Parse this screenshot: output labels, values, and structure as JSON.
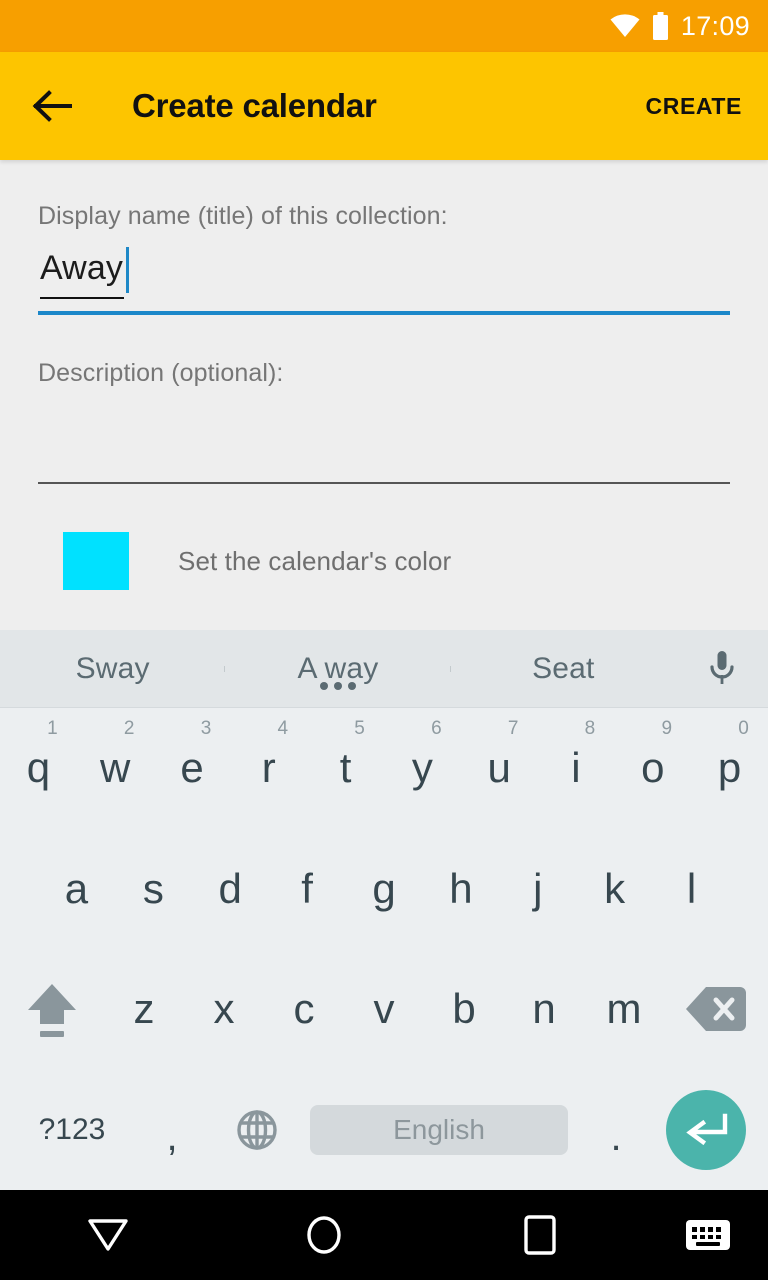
{
  "status_bar": {
    "time": "17:09",
    "wifi_icon": "wifi-icon",
    "battery_icon": "battery-icon",
    "background_color": "#f79f00"
  },
  "app_bar": {
    "back_icon": "arrow-left-icon",
    "title": "Create calendar",
    "action_label": "CREATE",
    "background_color": "#fdc500"
  },
  "form": {
    "name_label": "Display name (title) of this collection:",
    "name_value": "Away",
    "name_underline_color": "#1b87c9",
    "description_label": "Description (optional):",
    "description_value": "",
    "color_swatch": "#00e1ff",
    "color_label": "Set the calendar's color"
  },
  "keyboard": {
    "suggestions": [
      {
        "label": "Sway",
        "has_more_dots": false
      },
      {
        "label": "A way",
        "has_more_dots": true
      },
      {
        "label": "Seat",
        "has_more_dots": false
      }
    ],
    "mic_icon": "microphone-icon",
    "row1": [
      {
        "letter": "q",
        "num": "1"
      },
      {
        "letter": "w",
        "num": "2"
      },
      {
        "letter": "e",
        "num": "3"
      },
      {
        "letter": "r",
        "num": "4"
      },
      {
        "letter": "t",
        "num": "5"
      },
      {
        "letter": "y",
        "num": "6"
      },
      {
        "letter": "u",
        "num": "7"
      },
      {
        "letter": "i",
        "num": "8"
      },
      {
        "letter": "o",
        "num": "9"
      },
      {
        "letter": "p",
        "num": "0"
      }
    ],
    "row2": [
      "a",
      "s",
      "d",
      "f",
      "g",
      "h",
      "j",
      "k",
      "l"
    ],
    "row3": [
      "z",
      "x",
      "c",
      "v",
      "b",
      "n",
      "m"
    ],
    "shift_icon": "shift-arrow-up-icon",
    "backspace_icon": "backspace-delete-icon",
    "symbols_label": "?123",
    "comma_label": ",",
    "globe_icon": "globe-language-icon",
    "spacebar_label": "English",
    "period_label": ".",
    "enter_icon": "enter-return-icon",
    "enter_key_color": "#4bb4ab"
  },
  "nav_bar": {
    "back_icon": "nav-back-triangle-icon",
    "home_icon": "nav-home-circle-icon",
    "recents_icon": "nav-recents-square-icon",
    "keyboard_icon": "nav-keyboard-icon"
  }
}
